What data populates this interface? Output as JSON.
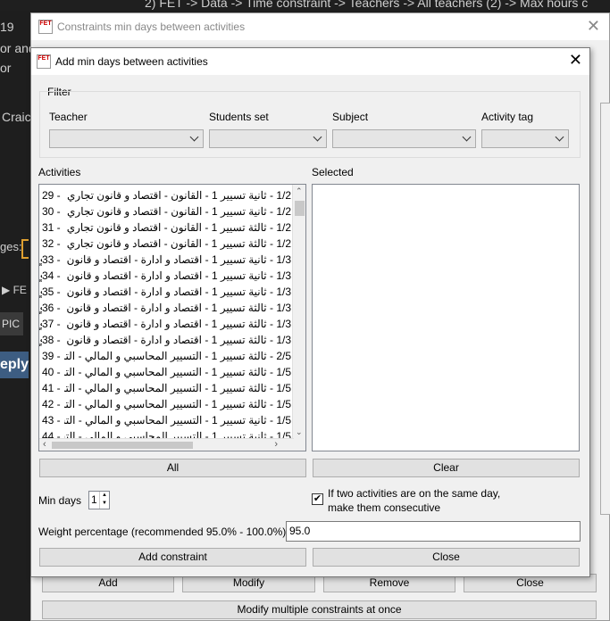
{
  "background": {
    "title": "2) FET -> Data -> Time constraint -> Teachers -> All teachers (2) -> Max hours c",
    "snippets": [
      "19",
      "or and",
      "or",
      "Craic",
      "ges:",
      "▶ FE",
      "PIC",
      "eply"
    ]
  },
  "outer_window": {
    "title": "Constraints min days between activities",
    "buttons": {
      "add": "Add",
      "modify": "Modify",
      "remove": "Remove",
      "close": "Close",
      "modify_multiple": "Modify multiple constraints at once"
    }
  },
  "dialog": {
    "title": "Add min days between activities",
    "filter": {
      "label": "Filter",
      "teacher_label": "Teacher",
      "students_label": "Students set",
      "subject_label": "Subject",
      "activity_tag_label": "Activity tag"
    },
    "activities_label": "Activities",
    "selected_label": "Selected",
    "activities": [
      {
        "num": "29 -",
        "text": "1/2 - ثانية تسيير 1 - القانون - اقتصاد و قانون تجاري"
      },
      {
        "num": "30 -",
        "text": "1/2 - ثانية تسيير 1 - القانون - اقتصاد و قانون تجاري"
      },
      {
        "num": "31 -",
        "text": "1/2 - ثالثة تسيير 1 - القانون - اقتصاد و قانون تجاري"
      },
      {
        "num": "32 -",
        "text": "1/2 - ثالثة تسيير 1 - القانون - اقتصاد و قانون تجاري"
      },
      {
        "num": "33 -",
        "text": "1/3 - ثانية تسيير 1 - اقتصاد و ادارة - اقتصاد و قانون تجاري"
      },
      {
        "num": "34 -",
        "text": "1/3 - ثانية تسيير 1 - اقتصاد و ادارة - اقتصاد و قانون تجاري"
      },
      {
        "num": "35 -",
        "text": "1/3 - ثانية تسيير 1 - اقتصاد و ادارة - اقتصاد و قانون تجاري"
      },
      {
        "num": "36 -",
        "text": "1/3 - ثالثة تسيير 1 - اقتصاد و ادارة - اقتصاد و قانون تجاري"
      },
      {
        "num": "37 -",
        "text": "1/3 - ثالثة تسيير 1 - اقتصاد و ادارة - اقتصاد و قانون تجاري"
      },
      {
        "num": "38 -",
        "text": "1/3 - ثالثة تسيير 1 - اقتصاد و ادارة - اقتصاد و قانون تجاري"
      },
      {
        "num": "39 -",
        "text": "2/5 - ثالثة تسيير 1 - التسيير المحاسبي و المالي - التسيير"
      },
      {
        "num": "40 -",
        "text": "1/5 - ثالثة تسيير 1 - التسيير المحاسبي و المالي - التسيير"
      },
      {
        "num": "41 -",
        "text": "1/5 - ثالثة تسيير 1 - التسيير المحاسبي و المالي - التسيير"
      },
      {
        "num": "42 -",
        "text": "1/5 - ثالثة تسيير 1 - التسيير المحاسبي و المالي - التسيير"
      },
      {
        "num": "43 -",
        "text": "1/5 - ثانية تسيير 1 - التسيير المحاسبي و المالي - التسيير"
      },
      {
        "num": "44 -",
        "text": "1/5 - ثانية تسيير 1 - التسيير المحاسبي و المالي - التسيير"
      }
    ],
    "all_button": "All",
    "clear_button": "Clear",
    "min_days_label": "Min days",
    "min_days_value": "1",
    "consecutive_line1": "If two activities are on the same day,",
    "consecutive_line2": "make them consecutive",
    "consecutive_checked": "✔",
    "weight_label": "Weight percentage (recommended 95.0% - 100.0%)",
    "weight_value": "95.0",
    "add_button": "Add constraint",
    "close_button": "Close"
  }
}
